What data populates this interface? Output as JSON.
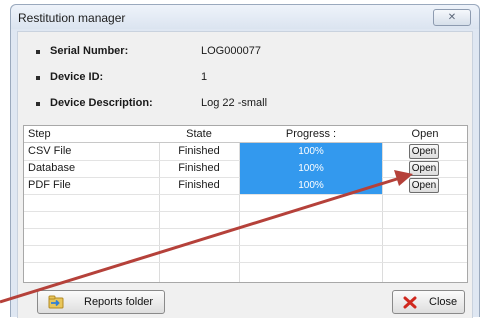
{
  "window": {
    "title": "Restitution manager",
    "close_glyph": "✕"
  },
  "device_info": [
    {
      "label": "Serial Number:",
      "value": "LOG000077"
    },
    {
      "label": "Device ID:",
      "value": "1"
    },
    {
      "label": "Device Description:",
      "value": "Log 22 -small"
    }
  ],
  "table": {
    "headers": {
      "step": "Step",
      "state": "State",
      "progress": "Progress :",
      "open": "Open"
    },
    "rows": [
      {
        "step": "CSV File",
        "state": "Finished",
        "progress_text": "100%",
        "progress_fraction": 1.0,
        "open_label": "Open"
      },
      {
        "step": "Database",
        "state": "Finished",
        "progress_text": "100%",
        "progress_fraction": 1.0,
        "open_label": "Open"
      },
      {
        "step": "PDF File",
        "state": "Finished",
        "progress_text": "100%",
        "progress_fraction": 1.0,
        "open_label": "Open"
      }
    ]
  },
  "buttons": {
    "reports_folder": "Reports folder",
    "close": "Close"
  },
  "icons": {
    "reports": "folder-arrow-icon",
    "close": "red-x-icon",
    "window_close": "close-icon"
  },
  "colors": {
    "progress_fill": "#3399ee",
    "annotation_arrow": "#b5413a",
    "close_icon": "#d0281e"
  }
}
